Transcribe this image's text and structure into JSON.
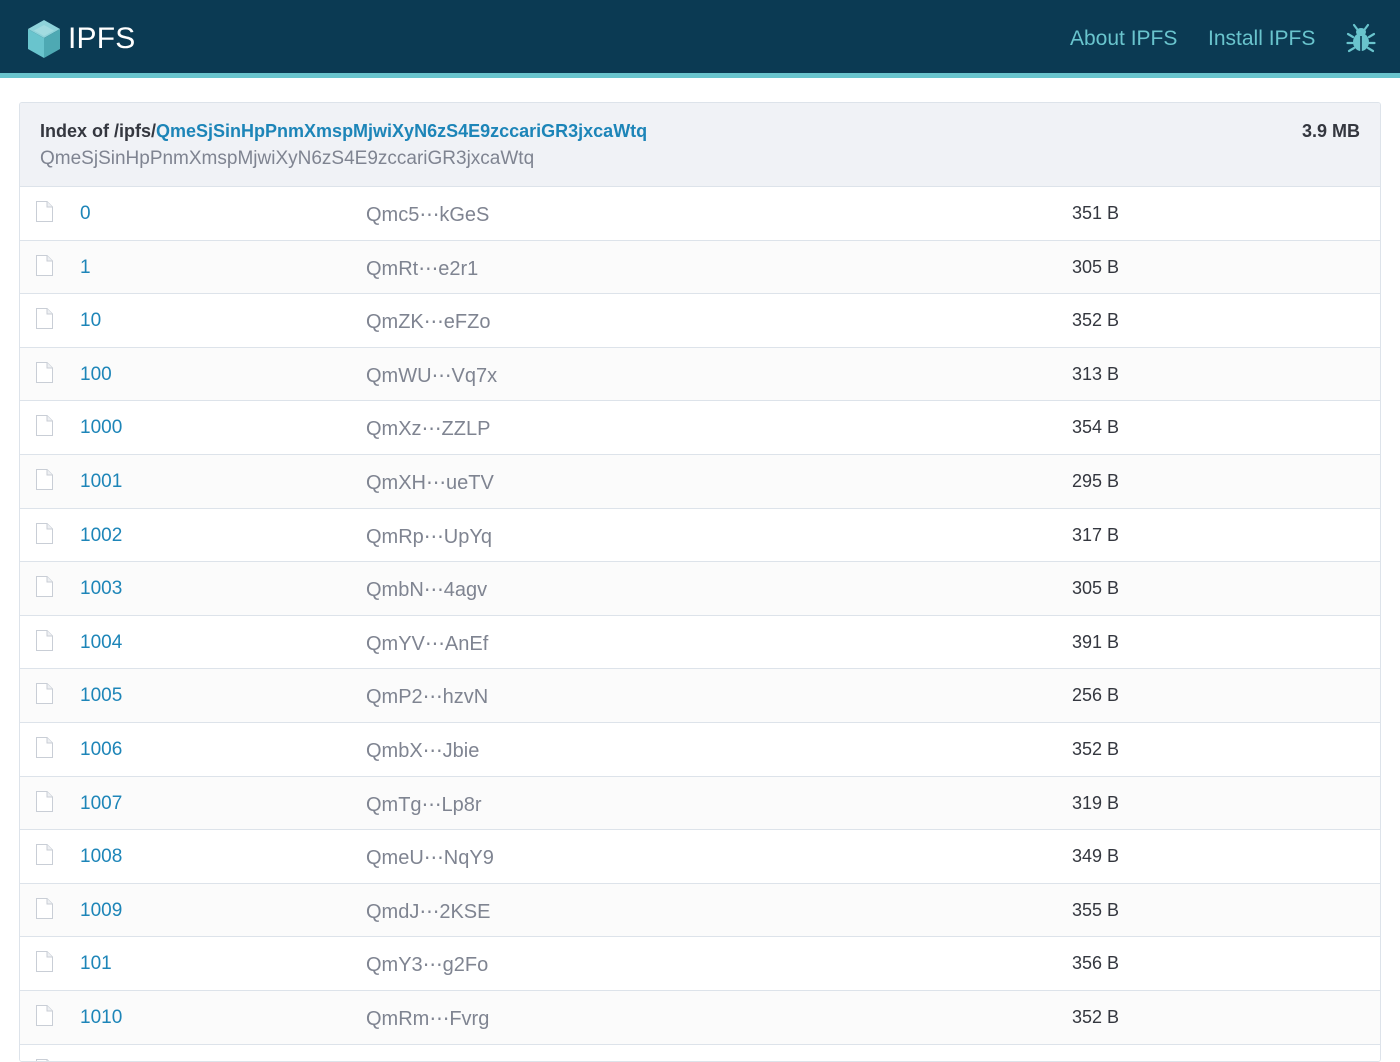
{
  "header": {
    "brand": "IPFS",
    "nav": {
      "about": "About IPFS",
      "install": "Install IPFS"
    },
    "icons": {
      "logo": "ipfs-cube-icon",
      "bug": "bug-icon"
    },
    "colors": {
      "bar": "#0b3a53",
      "accent": "#69c4cd",
      "link": "#1d85b8"
    }
  },
  "listing": {
    "index_prefix": "Index of /ipfs/",
    "cid": "QmeSjSinHpPnmXmspMjwiXyN6zS4E9zccariGR3jxcaWtq",
    "cid_subtitle": "QmeSjSinHpPnmXmspMjwiXyN6zS4E9zccariGR3jxcaWtq",
    "total_size": "3.9 MB",
    "rows": [
      {
        "name": "0",
        "hash": "Qmc5⋯kGeS",
        "size": "351 B"
      },
      {
        "name": "1",
        "hash": "QmRt⋯e2r1",
        "size": "305 B"
      },
      {
        "name": "10",
        "hash": "QmZK⋯eFZo",
        "size": "352 B"
      },
      {
        "name": "100",
        "hash": "QmWU⋯Vq7x",
        "size": "313 B"
      },
      {
        "name": "1000",
        "hash": "QmXz⋯ZZLP",
        "size": "354 B"
      },
      {
        "name": "1001",
        "hash": "QmXH⋯ueTV",
        "size": "295 B"
      },
      {
        "name": "1002",
        "hash": "QmRp⋯UpYq",
        "size": "317 B"
      },
      {
        "name": "1003",
        "hash": "QmbN⋯4agv",
        "size": "305 B"
      },
      {
        "name": "1004",
        "hash": "QmYV⋯AnEf",
        "size": "391 B"
      },
      {
        "name": "1005",
        "hash": "QmP2⋯hzvN",
        "size": "256 B"
      },
      {
        "name": "1006",
        "hash": "QmbX⋯Jbie",
        "size": "352 B"
      },
      {
        "name": "1007",
        "hash": "QmTg⋯Lp8r",
        "size": "319 B"
      },
      {
        "name": "1008",
        "hash": "QmeU⋯NqY9",
        "size": "349 B"
      },
      {
        "name": "1009",
        "hash": "QmdJ⋯2KSE",
        "size": "355 B"
      },
      {
        "name": "101",
        "hash": "QmY3⋯g2Fo",
        "size": "356 B"
      },
      {
        "name": "1010",
        "hash": "QmRm⋯Fvrg",
        "size": "352 B"
      },
      {
        "name": "",
        "hash": "",
        "size": ""
      }
    ]
  }
}
